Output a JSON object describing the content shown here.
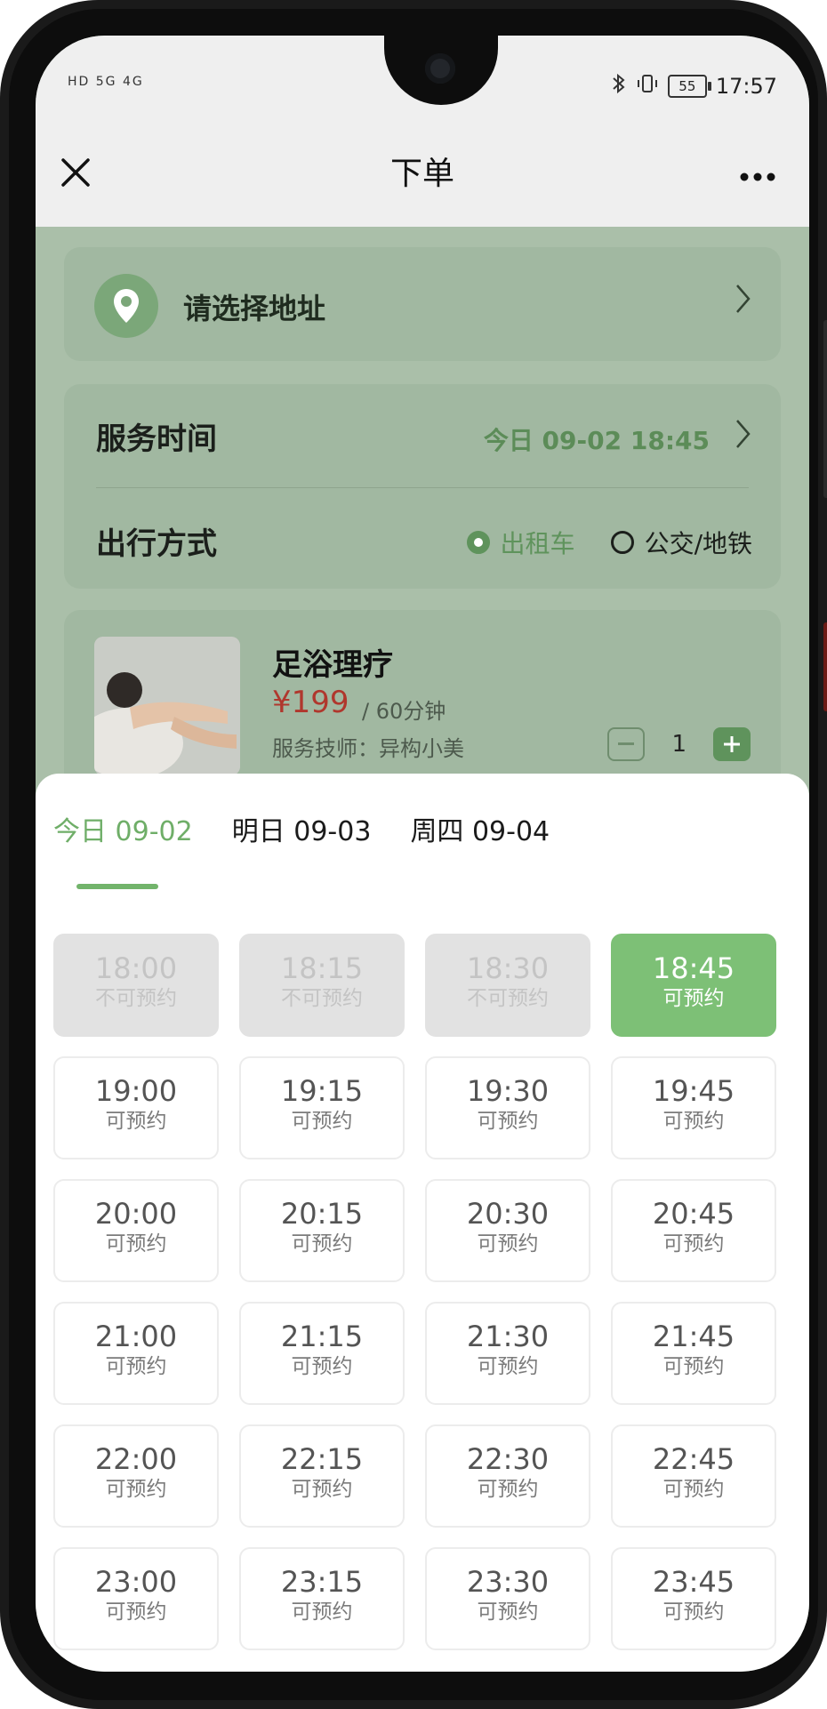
{
  "status_bar": {
    "left_indicators": "HD 5G 4G",
    "time": "17:57",
    "battery": "55"
  },
  "nav": {
    "title": "下单"
  },
  "address": {
    "label": "请选择地址"
  },
  "service_time": {
    "label": "服务时间",
    "value": "今日 09-02 18:45"
  },
  "travel": {
    "label": "出行方式",
    "options": [
      "出租车",
      "公交/地铁"
    ],
    "selected": "出租车"
  },
  "service": {
    "name": "足浴理疗",
    "price": "¥199",
    "duration": "/ 60分钟",
    "technician": "服务技师：异构小美",
    "quantity": "1"
  },
  "date_tabs": [
    {
      "label": "今日 09-02",
      "active": true
    },
    {
      "label": "明日 09-03",
      "active": false
    },
    {
      "label": "周四 09-04",
      "active": false
    }
  ],
  "slots": [
    {
      "time": "18:00",
      "status": "不可预约",
      "state": "disabled"
    },
    {
      "time": "18:15",
      "status": "不可预约",
      "state": "disabled"
    },
    {
      "time": "18:30",
      "status": "不可预约",
      "state": "disabled"
    },
    {
      "time": "18:45",
      "status": "可预约",
      "state": "selected"
    },
    {
      "time": "19:00",
      "status": "可预约",
      "state": "available"
    },
    {
      "time": "19:15",
      "status": "可预约",
      "state": "available"
    },
    {
      "time": "19:30",
      "status": "可预约",
      "state": "available"
    },
    {
      "time": "19:45",
      "status": "可预约",
      "state": "available"
    },
    {
      "time": "20:00",
      "status": "可预约",
      "state": "available"
    },
    {
      "time": "20:15",
      "status": "可预约",
      "state": "available"
    },
    {
      "time": "20:30",
      "status": "可预约",
      "state": "available"
    },
    {
      "time": "20:45",
      "status": "可预约",
      "state": "available"
    },
    {
      "time": "21:00",
      "status": "可预约",
      "state": "available"
    },
    {
      "time": "21:15",
      "status": "可预约",
      "state": "available"
    },
    {
      "time": "21:30",
      "status": "可预约",
      "state": "available"
    },
    {
      "time": "21:45",
      "status": "可预约",
      "state": "available"
    },
    {
      "time": "22:00",
      "status": "可预约",
      "state": "available"
    },
    {
      "time": "22:15",
      "status": "可预约",
      "state": "available"
    },
    {
      "time": "22:30",
      "status": "可预约",
      "state": "available"
    },
    {
      "time": "22:45",
      "status": "可预约",
      "state": "available"
    },
    {
      "time": "23:00",
      "status": "可预约",
      "state": "available"
    },
    {
      "time": "23:15",
      "status": "可预约",
      "state": "available"
    },
    {
      "time": "23:30",
      "status": "可预约",
      "state": "available"
    },
    {
      "time": "23:45",
      "status": "可预约",
      "state": "available"
    }
  ],
  "colors": {
    "accent_green": "#7dc076",
    "overlay_green": "#aabfa9",
    "price_red": "#b0372d"
  }
}
